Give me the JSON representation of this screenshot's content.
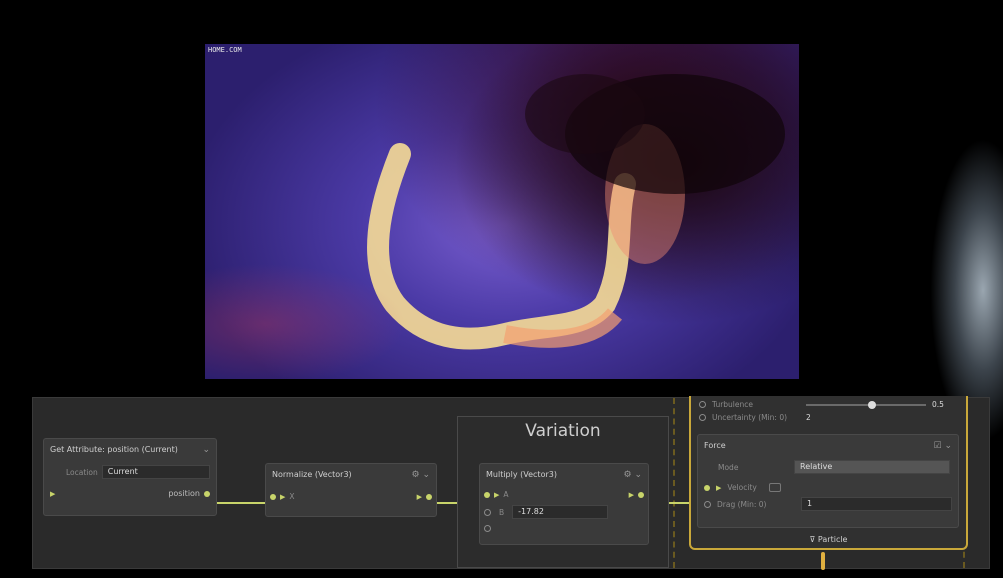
{
  "viewport": {
    "tag": "HOME.COM"
  },
  "nodes": {
    "get_attribute": {
      "title": "Get Attribute: position (Current)",
      "location_label": "Location",
      "location_value": "Current",
      "output_label": "position"
    },
    "normalize": {
      "title": "Normalize (Vector3)",
      "input_label": "X"
    },
    "multiply": {
      "title": "Multiply (Vector3)",
      "input_a": "A",
      "input_b": "B",
      "b_value": "-17.82"
    },
    "variation": {
      "title": "Variation"
    },
    "context": {
      "row1_label": "Turbulence",
      "row1_value": "0.5",
      "slider_fraction": 0.55,
      "row2_label": "Uncertainty (Min: 0)",
      "row2_value": "2",
      "force_title": "Force",
      "mode_label": "Mode",
      "mode_value": "Relative",
      "velocity_label": "Velocity",
      "drag_label": "Drag (Min: 0)",
      "drag_value": "1",
      "footer": "Particle"
    }
  },
  "colors": {
    "wire": "#c8d46a",
    "context_border": "#c9a83a"
  }
}
